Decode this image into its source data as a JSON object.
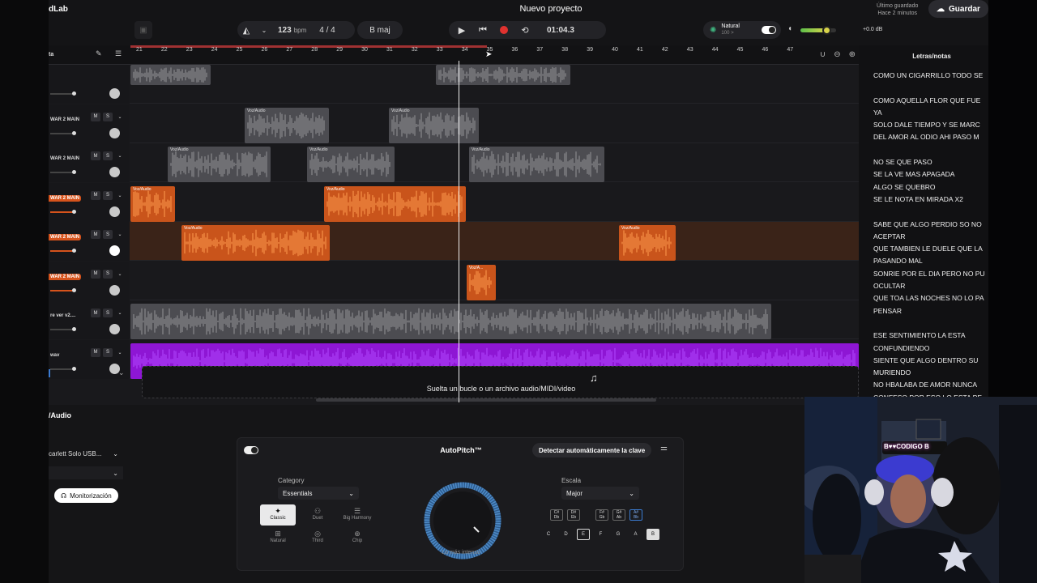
{
  "app": {
    "brand": "dLab",
    "project_title": "Nuevo proyecto"
  },
  "transport": {
    "tempo": "123",
    "tempo_unit": "bpm",
    "time_signature": "4 / 4",
    "key": "B maj",
    "time": "01:04.3"
  },
  "master": {
    "preset": "Natural",
    "preset_value": "100 >",
    "volume": "+0.0 dB",
    "volume_level": 0.72
  },
  "save": {
    "last_saved_label": "Último guardado",
    "last_saved_time": "Hace 2 minutos",
    "button": "Guardar"
  },
  "ruler": {
    "header_label": "ta",
    "bars": [
      "21",
      "22",
      "23",
      "24",
      "25",
      "26",
      "27",
      "28",
      "29",
      "30",
      "31",
      "32",
      "33",
      "34",
      "35",
      "36",
      "37",
      "38",
      "39",
      "40",
      "41",
      "42",
      "43",
      "44",
      "45",
      "46",
      "47"
    ]
  },
  "tracks": [
    {
      "name": "",
      "orange": false,
      "ms": false,
      "clips": [
        {
          "label": "",
          "color": "gray"
        },
        {
          "label": "",
          "color": "gray"
        }
      ]
    },
    {
      "name": "WAR 2 MAIN",
      "orange": false,
      "ms": true,
      "clips": [
        {
          "label": "Voz/Audio",
          "color": "gray"
        },
        {
          "label": "Voz/Audio",
          "color": "gray"
        }
      ]
    },
    {
      "name": "WAR 2 MAIN",
      "orange": false,
      "ms": true,
      "clips": [
        {
          "label": "Voz/Audio",
          "color": "gray"
        },
        {
          "label": "Voz/Audio",
          "color": "gray"
        },
        {
          "label": "Voz/Audio",
          "color": "gray"
        }
      ]
    },
    {
      "name": "WAR 2 MAIN",
      "orange": true,
      "ms": true,
      "clips": [
        {
          "label": "Voz/Audio",
          "color": "orange"
        },
        {
          "label": "Voz/Audio",
          "color": "orange"
        }
      ]
    },
    {
      "name": "WAR 2 MAIN",
      "orange": true,
      "ms": true,
      "clips": [
        {
          "label": "Voz/Audio",
          "color": "orange"
        },
        {
          "label": "Voz/Audio",
          "color": "orange"
        }
      ]
    },
    {
      "name": "WAR 2 MAIN",
      "orange": true,
      "ms": true,
      "clips": [
        {
          "label": "Voz/A...",
          "color": "orange"
        }
      ]
    },
    {
      "name": "re ver v2....",
      "orange": false,
      "ms": true,
      "clips": [
        {
          "label": "",
          "color": "gray"
        }
      ]
    },
    {
      "name": "wav",
      "orange": false,
      "ms": true,
      "clips": [
        {
          "label": "",
          "color": "purple"
        }
      ]
    }
  ],
  "dropzone": {
    "text": "Suelta un bucle o un archivo audio/MIDI/video"
  },
  "lyrics": {
    "title": "Letras/notas",
    "lines": [
      "COMO UN CIGARRILLO TODO SE",
      "",
      "COMO AQUELLA FLOR QUE FUE",
      "YA",
      "SOLO DALE  TIEMPO Y SE  MARC",
      " DEL AMOR AL ODIO AHI PASO M",
      "",
      "NO SE QUE PASO",
      "SE LA VE MAS APAGADA",
      "ALGO SE QUEBRO",
      "SE LE NOTA EN MIRADA X2",
      "",
      "SABE QUE ALGO PERDIO SO NO",
      "ACEPTAR",
      "QUE TAMBIEN LE DUELE QUE LA",
      "PASANDO MAL",
      "SONRIE POR EL DIA PERO NO PU",
      "OCULTAR",
      "QUE TOA LAS NOCHES NO LO PA",
      "PENSAR",
      "",
      "ESE SENTIMIENTO LA ESTA",
      "CONFUNDIENDO",
      "SIENTE QUE ALGO DENTRO   SU",
      "MURIENDO",
      "NO HBALABA DE AMOR NUNCA",
      "CONFESO   POR ESO LO ESTA PE"
    ]
  },
  "panel": {
    "title": "/Audio",
    "input_device": "carlett Solo USB...",
    "input_channel": "",
    "monitor_button": "Monitorización"
  },
  "autopitch": {
    "title": "AutoPitch™",
    "detect_button": "Detectar automáticamente la clave",
    "category_label": "Category",
    "category_value": "Essentials",
    "styles": [
      "Classic",
      "Duet",
      "Big Harmony",
      "Natural",
      "Third",
      "Chip"
    ],
    "active_style": "Classic",
    "scale_label": "Escala",
    "scale_value": "Major",
    "dial_label": "Lo más intenso",
    "sharps": [
      "C#\nDb",
      "D#\nEb",
      "F#\nGb",
      "G#\nAb",
      "A#\nBb"
    ],
    "naturals": [
      "C",
      "D",
      "E",
      "F",
      "G",
      "A",
      "B"
    ],
    "selected_keys": [
      "E",
      "B"
    ]
  },
  "webcam": {
    "sign": "B♥♥CODIGO B"
  },
  "colors": {
    "accent_orange": "#d6531c",
    "purple": "#8e16d4",
    "record": "#e0322f"
  }
}
